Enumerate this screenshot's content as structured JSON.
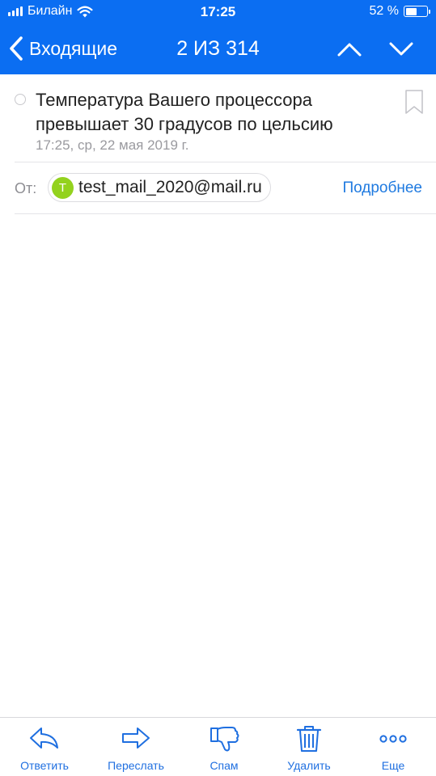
{
  "status_bar": {
    "carrier": "Билайн",
    "time": "17:25",
    "battery_text": "52 %",
    "battery_level": 0.52
  },
  "nav": {
    "back_label": "Входящие",
    "counter": "2 ИЗ 314"
  },
  "email": {
    "subject": "Температура Вашего процессора превышает 30 градусов по цельсию",
    "date": "17:25, ср, 22 мая 2019 г.",
    "from_label": "От:",
    "sender_initial": "T",
    "sender_email": "test_mail_2020@mail.ru",
    "details_label": "Подробнее"
  },
  "toolbar": {
    "reply": "Ответить",
    "forward": "Переслать",
    "spam": "Спам",
    "delete": "Удалить",
    "more": "Еще"
  },
  "colors": {
    "header_blue": "#0b6ef2",
    "link_blue": "#1f7ae0",
    "avatar_green": "#93d21e"
  }
}
